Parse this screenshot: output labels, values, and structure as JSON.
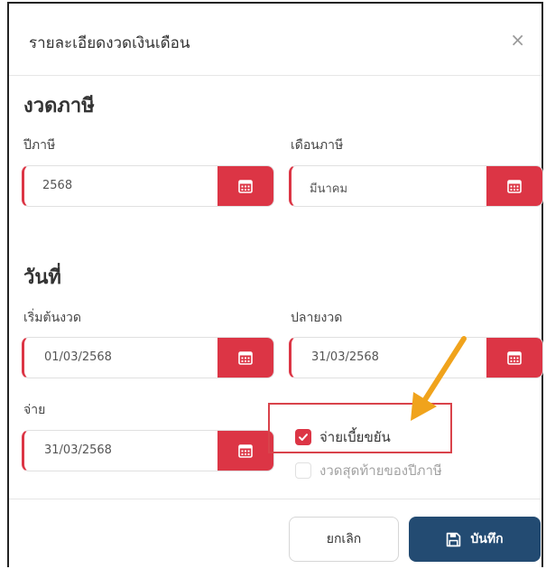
{
  "modal": {
    "title": "รายละเอียดงวดเงินเดือน",
    "close_symbol": "×"
  },
  "tax_period": {
    "section_title": "งวดภาษี",
    "tax_year_label": "ปีภาษี",
    "tax_year_value": "2568",
    "tax_month_label": "เดือนภาษี",
    "tax_month_value": "มีนาคม"
  },
  "dates": {
    "section_title": "วันที่",
    "start_label": "เริ่มต้นงวด",
    "start_value": "01/03/2568",
    "end_label": "ปลายงวด",
    "end_value": "31/03/2568",
    "pay_label": "จ่าย",
    "pay_value": "31/03/2568"
  },
  "options": {
    "bonus_label": "จ่ายเบี้ยขยัน",
    "bonus_checked": true,
    "last_period_label": "งวดสุดท้ายของปีภาษี",
    "last_period_checked": false
  },
  "footer": {
    "cancel_label": "ยกเลิก",
    "save_label": "บันทึก"
  },
  "colors": {
    "accent_red": "#dc3545",
    "save_blue": "#234b72",
    "annotation_orange": "#f0a31c"
  },
  "icons": {
    "calendar": "calendar-icon",
    "save": "floppy-disk-icon",
    "check": "check-icon"
  }
}
